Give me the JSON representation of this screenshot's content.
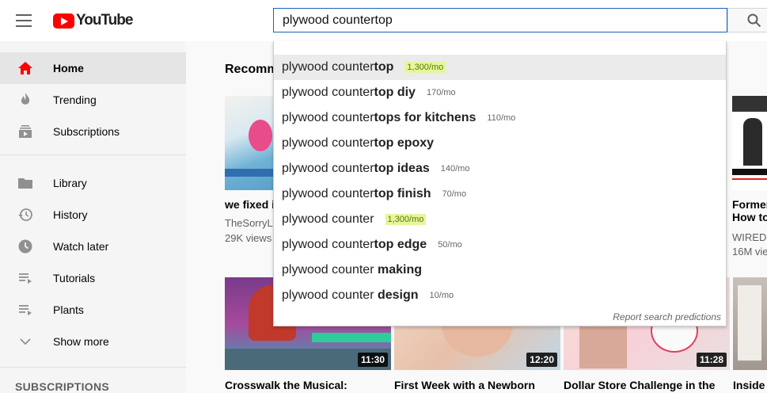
{
  "header": {
    "logo_text": "YouTube",
    "search_value": "plywood countertop"
  },
  "sidebar": {
    "items": [
      {
        "label": "Home",
        "icon": "home-icon"
      },
      {
        "label": "Trending",
        "icon": "fire-icon"
      },
      {
        "label": "Subscriptions",
        "icon": "subscriptions-icon"
      },
      {
        "label": "Library",
        "icon": "folder-icon"
      },
      {
        "label": "History",
        "icon": "history-icon"
      },
      {
        "label": "Watch later",
        "icon": "clock-icon"
      },
      {
        "label": "Tutorials",
        "icon": "playlist-icon"
      },
      {
        "label": "Plants",
        "icon": "playlist-icon"
      },
      {
        "label": "Show more",
        "icon": "chevron-down-icon"
      }
    ],
    "section_title": "SUBSCRIPTIONS"
  },
  "main": {
    "heading": "Recomm",
    "videos_top": [
      {
        "title": "we fixed it",
        "channel": "TheSorryLi",
        "views": "29K views"
      },
      {
        "title": "Former",
        "title2": "How to",
        "channel": "WIRED",
        "views": "16M vie"
      }
    ],
    "videos_bottom": [
      {
        "title": "Crosswalk the Musical:",
        "duration": "11:30"
      },
      {
        "title": "First Week with a Newborn",
        "duration": "12:20"
      },
      {
        "title": "Dollar Store Challenge in the",
        "duration": "11:28"
      },
      {
        "title": "Inside",
        "duration": ""
      }
    ]
  },
  "suggestions": {
    "typed": "plywood counter",
    "rows": [
      {
        "prefix": "plywood counter",
        "rest": "top",
        "volume": "1,300/mo",
        "hot": true
      },
      {
        "prefix": "plywood counter",
        "rest": "top diy",
        "volume": "170/mo",
        "hot": false
      },
      {
        "prefix": "plywood counter",
        "rest": "tops for kitchens",
        "volume": "110/mo",
        "hot": false
      },
      {
        "prefix": "plywood counter",
        "rest": "top epoxy",
        "volume": "",
        "hot": false
      },
      {
        "prefix": "plywood counter",
        "rest": "top ideas",
        "volume": "140/mo",
        "hot": false
      },
      {
        "prefix": "plywood counter",
        "rest": "top finish",
        "volume": "70/mo",
        "hot": false
      },
      {
        "prefix": "plywood counter",
        "rest": "",
        "volume": "1,300/mo",
        "hot": true
      },
      {
        "prefix": "plywood counter",
        "rest": "top edge",
        "volume": "50/mo",
        "hot": false
      },
      {
        "prefix": "plywood counter ",
        "rest": "making",
        "volume": "",
        "hot": false
      },
      {
        "prefix": "plywood counter ",
        "rest": "design",
        "volume": "10/mo",
        "hot": false
      }
    ],
    "report_label": "Report search predictions"
  }
}
